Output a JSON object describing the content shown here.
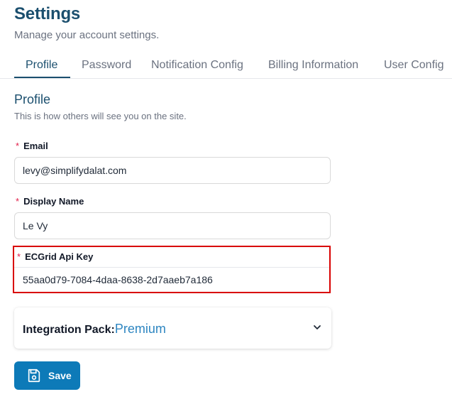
{
  "header": {
    "title": "Settings",
    "subtitle": "Manage your account settings."
  },
  "tabs": [
    {
      "label": "Profile",
      "active": true
    },
    {
      "label": "Password",
      "active": false
    },
    {
      "label": "Notification Config",
      "active": false
    },
    {
      "label": "Billing Information",
      "active": false
    },
    {
      "label": "User Config",
      "active": false
    }
  ],
  "profile_section": {
    "title": "Profile",
    "subtitle": "This is how others will see you on the site."
  },
  "form": {
    "required_mark": "*",
    "email": {
      "label": "Email",
      "value": "levy@simplifydalat.com"
    },
    "display_name": {
      "label": "Display Name",
      "value": "Le Vy"
    },
    "api_key": {
      "label": "ECGrid Api Key",
      "value": "55aa0d79-7084-4daa-8638-2d7aaeb7a186"
    }
  },
  "integration_pack": {
    "label": "Integration Pack:",
    "value": "Premium"
  },
  "save_button": {
    "label": "Save"
  },
  "icons": {
    "chevron": "chevron-down-icon",
    "save": "floppy-disk-icon"
  },
  "colors": {
    "primary": "#1b4f6e",
    "button": "#0d7ab8",
    "accent_value": "#2e86c1",
    "required": "#e11d48",
    "highlight_border": "#d90000"
  }
}
